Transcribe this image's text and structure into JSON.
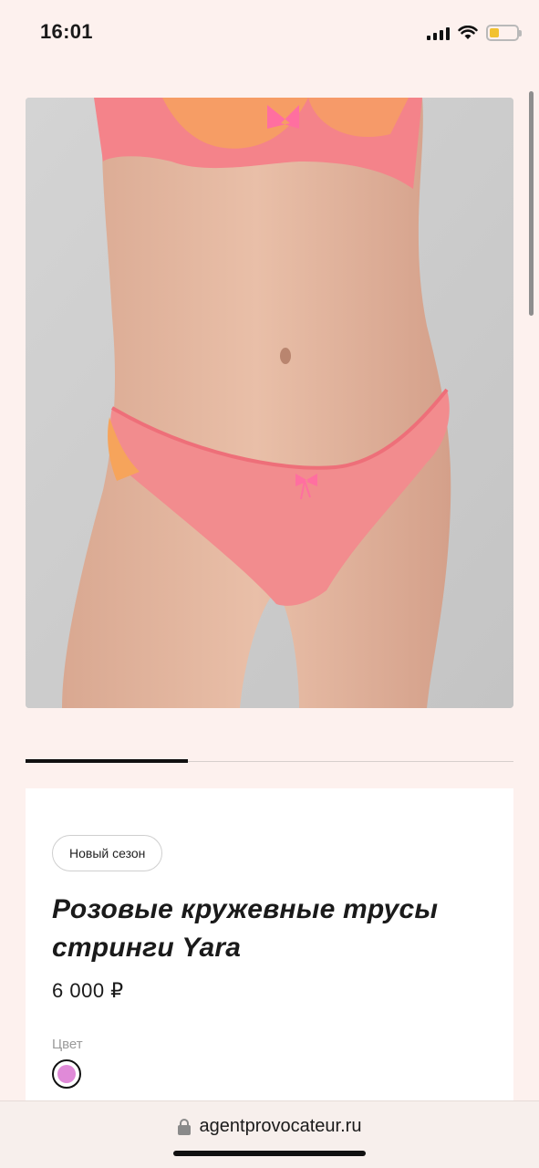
{
  "status_bar": {
    "time": "16:01",
    "icons": [
      "cellular-signal-icon",
      "wifi-icon",
      "battery-icon"
    ],
    "battery_color": "#f2c230"
  },
  "product": {
    "image_alt": "pink-lace-thong-product-photo",
    "badge": "Новый сезон",
    "title": "Розовые кружевные трусы стринги Yara",
    "price": "6 000 ₽",
    "color_label": "Цвет",
    "color_swatch": "#e08ad8",
    "carousel": {
      "active_index": 1,
      "total": 3
    }
  },
  "browser": {
    "url": "agentprovocateur.ru",
    "lock_icon": "lock-icon"
  },
  "colors": {
    "page_background": "#fdf1ee",
    "card_background": "#ffffff",
    "text": "#1a1a1a"
  }
}
